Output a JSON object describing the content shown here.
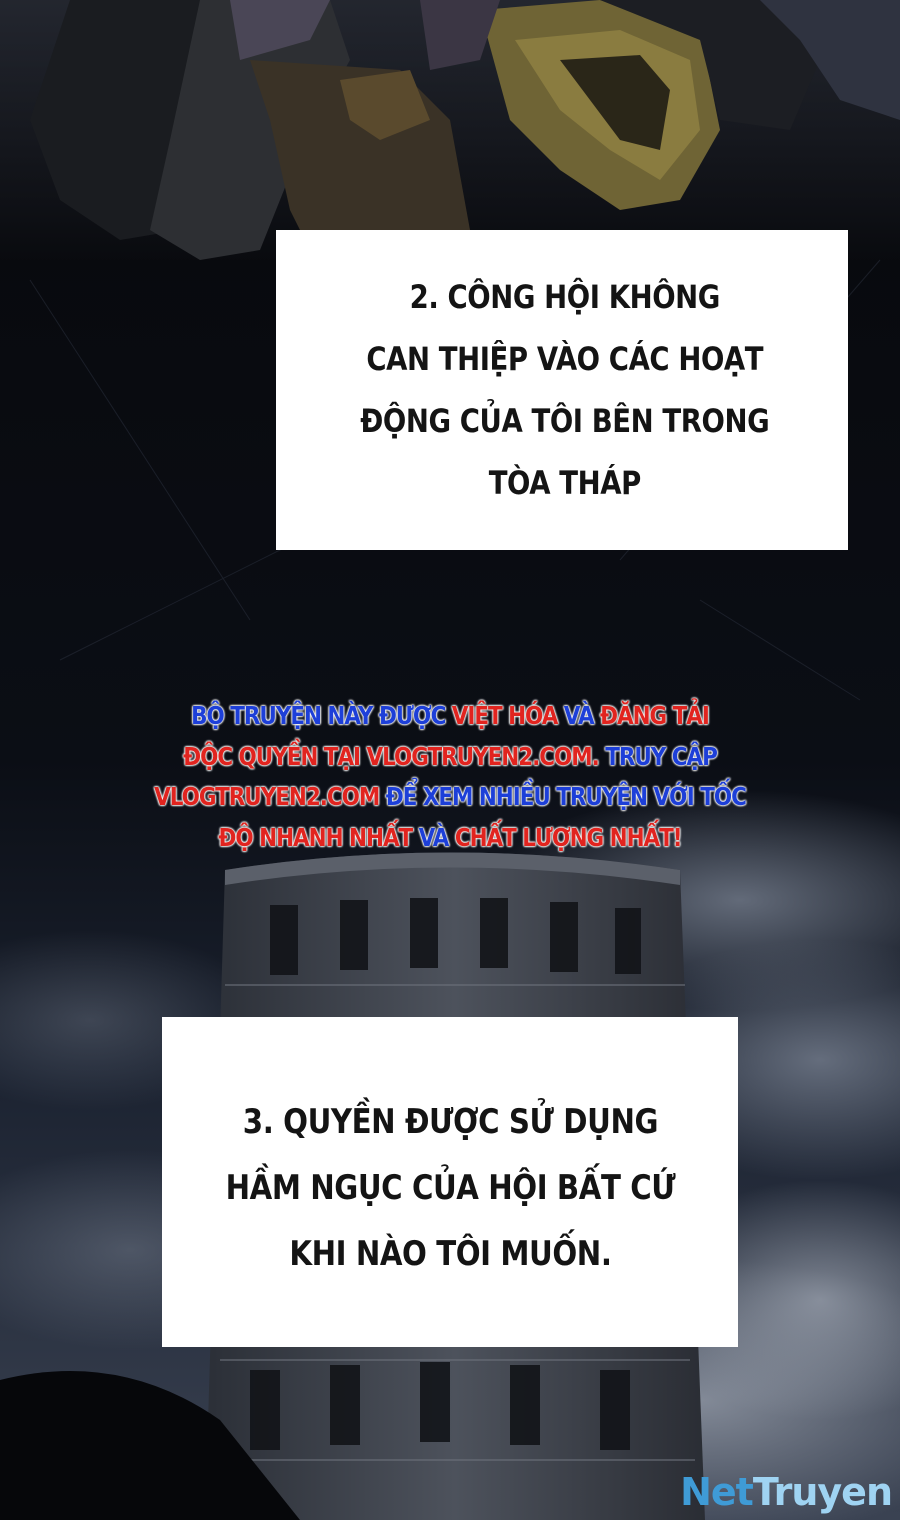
{
  "captions": {
    "item2": [
      "2. CÔNG HỘI KHÔNG",
      "CAN THIỆP VÀO CÁC HOẠT",
      "ĐỘNG CỦA TÔI BÊN TRONG",
      "TÒA THÁP"
    ],
    "item3": [
      "3. QUYỀN ĐƯỢC SỬ DỤNG",
      "HẦM NGỤC CỦA HỘI BẤT CỨ",
      "KHI NÀO TÔI MUỐN."
    ]
  },
  "notice": {
    "row1": [
      {
        "text": "BỘ TRUYỆN NÀY ĐƯỢC ",
        "color": "blue"
      },
      {
        "text": "VIỆT HÓA",
        "color": "red"
      },
      {
        "text": " VÀ ",
        "color": "blue"
      },
      {
        "text": "ĐĂNG TẢI",
        "color": "red"
      }
    ],
    "row2": [
      {
        "text": "ĐỘC QUYỀN TẠI ",
        "color": "red"
      },
      {
        "text": "VLOGTRUYEN2.COM.",
        "color": "red"
      },
      {
        "text": " TRUY CẬP",
        "color": "blue"
      }
    ],
    "row3": [
      {
        "text": "VLOGTRUYEN2.COM",
        "color": "red"
      },
      {
        "text": " ĐỂ XEM NHIỀU TRUYỆN VỚI TỐC",
        "color": "blue"
      }
    ],
    "row4": [
      {
        "text": "ĐỘ NHANH NHẤT",
        "color": "red"
      },
      {
        "text": " VÀ ",
        "color": "blue"
      },
      {
        "text": "CHẤT LƯỢNG NHẤT!",
        "color": "red"
      }
    ]
  },
  "watermark": {
    "part1": "Net",
    "part2": "Truyen"
  },
  "colors": {
    "background": "#07080b",
    "notice_blue": "#1d3fd8",
    "notice_red": "#e1241f",
    "caption_bg": "#ffffff",
    "caption_text": "#141414",
    "watermark": "#3f9bd6"
  },
  "artwork": {
    "top": "armored-figure-with-shoulder-pauldron",
    "bottom": "stone-tower-under-cloudy-sky"
  }
}
